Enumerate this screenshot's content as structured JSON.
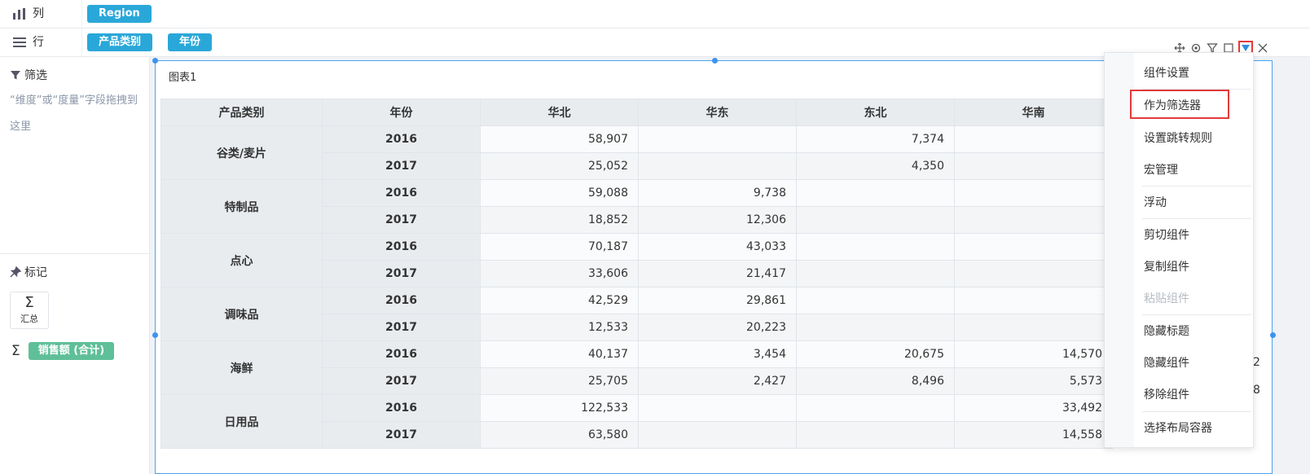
{
  "shelves": {
    "columns": {
      "title": "列",
      "fields": [
        "Region"
      ]
    },
    "rows": {
      "title": "行",
      "fields": [
        "产品类别",
        "年份"
      ]
    }
  },
  "left_panel": {
    "filter_title": "筛选",
    "filter_hint": "“维度”或“度量”字段拖拽到这里",
    "marks_title": "标记",
    "summary_symbol": "Σ",
    "summary_label": "汇总",
    "measure_symbol": "Σ",
    "measure_field": "销售额 (合计)"
  },
  "widget": {
    "title": "图表1"
  },
  "table": {
    "headers": [
      "产品类别",
      "年份",
      "华北",
      "华东",
      "东北",
      "华南"
    ],
    "groups": [
      {
        "category": "谷类/麦片",
        "rows": [
          {
            "year": "2016",
            "values": [
              "58,907",
              "",
              "7,374",
              ""
            ]
          },
          {
            "year": "2017",
            "values": [
              "25,052",
              "",
              "4,350",
              ""
            ]
          }
        ]
      },
      {
        "category": "特制品",
        "rows": [
          {
            "year": "2016",
            "values": [
              "59,088",
              "9,738",
              "",
              ""
            ]
          },
          {
            "year": "2017",
            "values": [
              "18,852",
              "12,306",
              "",
              ""
            ]
          }
        ]
      },
      {
        "category": "点心",
        "rows": [
          {
            "year": "2016",
            "values": [
              "70,187",
              "43,033",
              "",
              ""
            ]
          },
          {
            "year": "2017",
            "values": [
              "33,606",
              "21,417",
              "",
              ""
            ]
          }
        ]
      },
      {
        "category": "调味品",
        "rows": [
          {
            "year": "2016",
            "values": [
              "42,529",
              "29,861",
              "",
              ""
            ]
          },
          {
            "year": "2017",
            "values": [
              "12,533",
              "20,223",
              "",
              ""
            ]
          }
        ]
      },
      {
        "category": "海鲜",
        "rows": [
          {
            "year": "2016",
            "values": [
              "40,137",
              "3,454",
              "20,675",
              "14,570"
            ]
          },
          {
            "year": "2017",
            "values": [
              "25,705",
              "2,427",
              "8,496",
              "5,573"
            ]
          }
        ]
      },
      {
        "category": "日用品",
        "rows": [
          {
            "year": "2016",
            "values": [
              "122,533",
              "",
              "",
              "33,492"
            ]
          },
          {
            "year": "2017",
            "values": [
              "63,580",
              "",
              "",
              "14,558"
            ]
          }
        ]
      }
    ],
    "overflow_peek": [
      "2",
      "8"
    ]
  },
  "toolbar": {
    "icons": [
      "move-icon",
      "settings-icon",
      "filter-icon",
      "maximize-icon",
      "dropdown-icon",
      "close-icon"
    ]
  },
  "context_menu": {
    "items": [
      {
        "label": "组件设置"
      },
      {
        "label": "作为筛选器"
      },
      {
        "label": "设置跳转规则"
      },
      {
        "label": "宏管理"
      },
      {
        "label": "浮动"
      },
      {
        "label": "剪切组件"
      },
      {
        "label": "复制组件"
      },
      {
        "label": "粘贴组件"
      },
      {
        "label": "隐藏标题"
      },
      {
        "label": "隐藏组件"
      },
      {
        "label": "移除组件"
      },
      {
        "label": "选择布局容器"
      }
    ]
  },
  "colors": {
    "dimension_pill": "#2aa7d9",
    "measure_pill": "#5fbf99",
    "selection": "#4aa3f0",
    "highlight": "#e23a3a"
  }
}
